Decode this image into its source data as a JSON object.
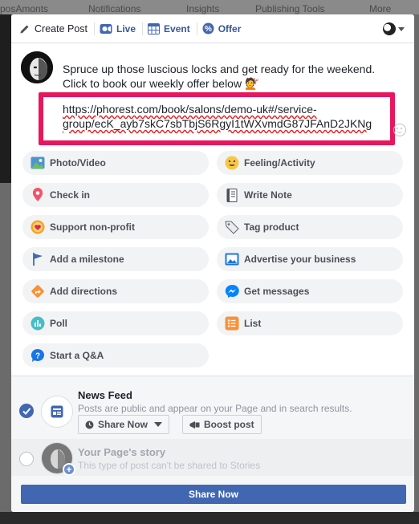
{
  "background_nav": [
    "posAmonts",
    "Notifications",
    "Insights",
    "Publishing Tools",
    "More"
  ],
  "tabs": {
    "create_post": "Create Post",
    "live": "Live",
    "event": "Event",
    "offer": "Offer"
  },
  "composer": {
    "text": "Spruce up those luscious locks and get ready for the weekend. Click to book our weekly offer below 💇",
    "link": "https://phorest.com/book/salons/demo-uk#/service-group/ecK_ayb7skC7sbTbjS6RgyI1tWXvmdG87JFAnD2JKNg"
  },
  "actions": [
    {
      "label": "Photo/Video",
      "icon": "photo-video-icon"
    },
    {
      "label": "Feeling/Activity",
      "icon": "feeling-icon"
    },
    {
      "label": "Check in",
      "icon": "check-in-icon"
    },
    {
      "label": "Write Note",
      "icon": "write-note-icon"
    },
    {
      "label": "Support non-profit",
      "icon": "support-nonprofit-icon"
    },
    {
      "label": "Tag product",
      "icon": "tag-product-icon"
    },
    {
      "label": "Add a milestone",
      "icon": "milestone-icon"
    },
    {
      "label": "Advertise your business",
      "icon": "advertise-icon"
    },
    {
      "label": "Add directions",
      "icon": "directions-icon"
    },
    {
      "label": "Get messages",
      "icon": "messenger-icon"
    },
    {
      "label": "Poll",
      "icon": "poll-icon"
    },
    {
      "label": "List",
      "icon": "list-icon"
    },
    {
      "label": "Start a Q&A",
      "icon": "qa-icon"
    }
  ],
  "audience": {
    "news_feed": {
      "title": "News Feed",
      "desc": "Posts are public and appear on your Page and in search results.",
      "share_now": "Share Now",
      "boost": "Boost post",
      "selected": true
    },
    "story": {
      "title": "Your Page's story",
      "desc": "This type of post can't be shared to Stories",
      "selected": false
    }
  },
  "share_button": "Share Now",
  "colors": {
    "accent": "#4267b2",
    "highlight": "#e8175d",
    "link_tab": "#365899"
  }
}
